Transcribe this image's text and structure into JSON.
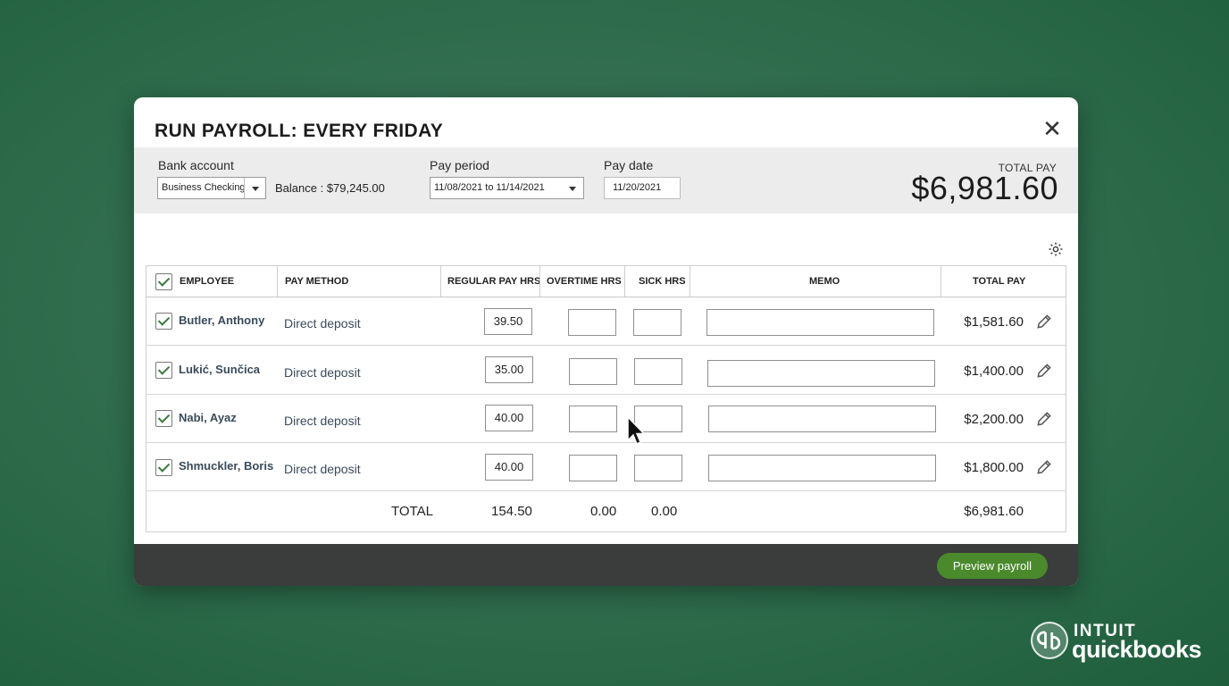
{
  "dialog": {
    "title": "RUN PAYROLL: EVERY FRIDAY",
    "close_icon": "close-icon"
  },
  "header": {
    "bank_account_label": "Bank account",
    "bank_account_value": "Business Checking",
    "balance_text": "Balance : $79,245.00",
    "pay_period_label": "Pay period",
    "pay_period_value": "11/08/2021 to 11/14/2021",
    "pay_date_label": "Pay date",
    "pay_date_value": "11/20/2021",
    "total_pay_label": "TOTAL PAY",
    "total_pay_value": "$6,981.60"
  },
  "settings_icon": "gear-icon",
  "table": {
    "columns": {
      "employee": "EMPLOYEE",
      "pay_method": "PAY METHOD",
      "regular_pay_hrs": "REGULAR PAY HRS",
      "overtime_hrs": "OVERTIME HRS",
      "sick_hrs": "SICK HRS",
      "memo": "MEMO",
      "total_pay": "TOTAL PAY"
    },
    "rows": [
      {
        "employee": "Butler, Anthony",
        "pay_method": "Direct deposit",
        "regular_hrs": "39.50",
        "overtime_hrs": "",
        "sick_hrs": "",
        "memo": "",
        "total_pay": "$1,581.60"
      },
      {
        "employee": "Lukić, Sunčica",
        "pay_method": "Direct deposit",
        "regular_hrs": "35.00",
        "overtime_hrs": "",
        "sick_hrs": "",
        "memo": "",
        "total_pay": "$1,400.00"
      },
      {
        "employee": "Nabi, Ayaz",
        "pay_method": "Direct deposit",
        "regular_hrs": "40.00",
        "overtime_hrs": "",
        "sick_hrs": "",
        "memo": "",
        "total_pay": "$2,200.00"
      },
      {
        "employee": "Shmuckler, Boris",
        "pay_method": "Direct deposit",
        "regular_hrs": "40.00",
        "overtime_hrs": "",
        "sick_hrs": "",
        "memo": "",
        "total_pay": "$1,800.00"
      }
    ],
    "totals": {
      "label": "TOTAL",
      "regular_hrs": "154.50",
      "overtime_hrs": "0.00",
      "sick_hrs": "0.00",
      "total_pay": "$6,981.60"
    }
  },
  "footer": {
    "preview_button": "Preview payroll"
  },
  "branding": {
    "line1": "INTUIT",
    "line2": "quickbooks"
  },
  "colors": {
    "accent_green": "#4a8a2c",
    "background_green": "#2c6a4a",
    "footer_dark": "#3b3c3c"
  }
}
